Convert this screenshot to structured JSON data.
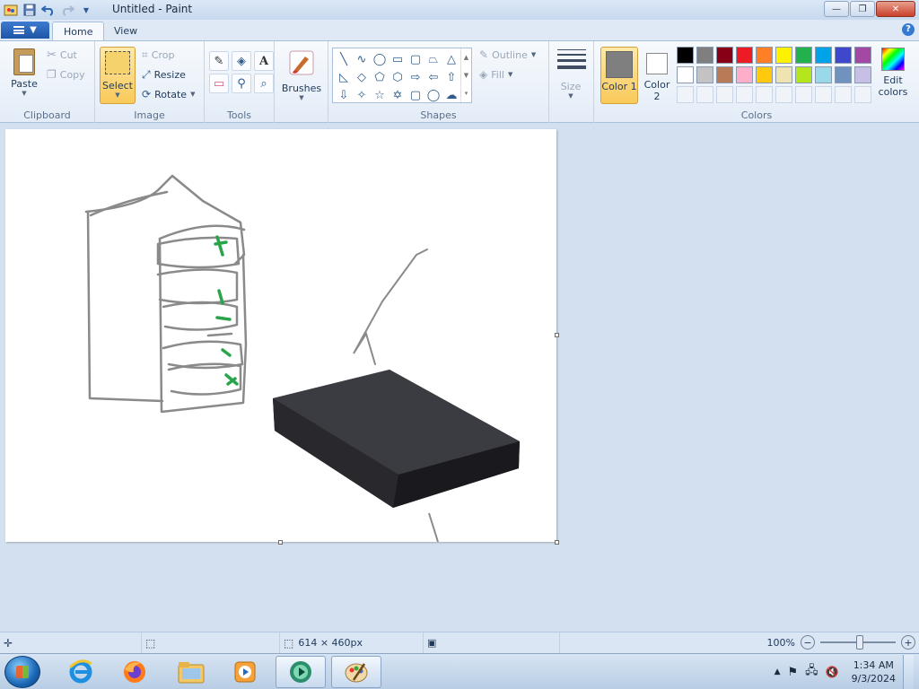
{
  "window": {
    "title": "Untitled - Paint",
    "minimize_glyph": "—",
    "maximize_glyph": "❐",
    "close_glyph": "✕"
  },
  "quick_access": [
    "save-icon",
    "undo-icon",
    "redo-icon",
    "customize-icon"
  ],
  "tabs": [
    {
      "label": "Home",
      "active": true
    },
    {
      "label": "View",
      "active": false
    }
  ],
  "ribbon": {
    "clipboard": {
      "label": "Clipboard",
      "paste": "Paste",
      "cut": "Cut",
      "copy": "Copy"
    },
    "image": {
      "label": "Image",
      "select": "Select",
      "crop": "Crop",
      "resize": "Resize",
      "rotate": "Rotate"
    },
    "tools": {
      "label": "Tools"
    },
    "brushes": {
      "label": "Brushes"
    },
    "shapes": {
      "label": "Shapes",
      "outline": "Outline",
      "fill": "Fill"
    },
    "size": {
      "label": "Size"
    },
    "colors": {
      "label": "Colors",
      "color1": "Color 1",
      "color2": "Color 2",
      "color1_value": "#7f7f7f",
      "color2_value": "#ffffff",
      "edit": "Edit colors",
      "palette_row1": [
        "#000000",
        "#7f7f7f",
        "#880015",
        "#ed1c24",
        "#ff7f27",
        "#fff200",
        "#22b14c",
        "#00a2e8",
        "#3f48cc",
        "#a349a4"
      ],
      "palette_row2": [
        "#ffffff",
        "#c3c3c3",
        "#b97a57",
        "#ffaec9",
        "#ffc90e",
        "#efe4b0",
        "#b5e61d",
        "#99d9ea",
        "#7092be",
        "#c8bfe7"
      ],
      "palette_row3": [
        "#f0f4f9",
        "#f0f4f9",
        "#f0f4f9",
        "#f0f4f9",
        "#f0f4f9",
        "#f0f4f9",
        "#f0f4f9",
        "#f0f4f9",
        "#f0f4f9",
        "#f0f4f9"
      ]
    }
  },
  "status": {
    "canvas_size": "614 × 460px",
    "zoom": "100%",
    "zoom_percent": 100
  },
  "taskbar": {
    "time": "1:34 AM",
    "date": "9/3/2024"
  }
}
